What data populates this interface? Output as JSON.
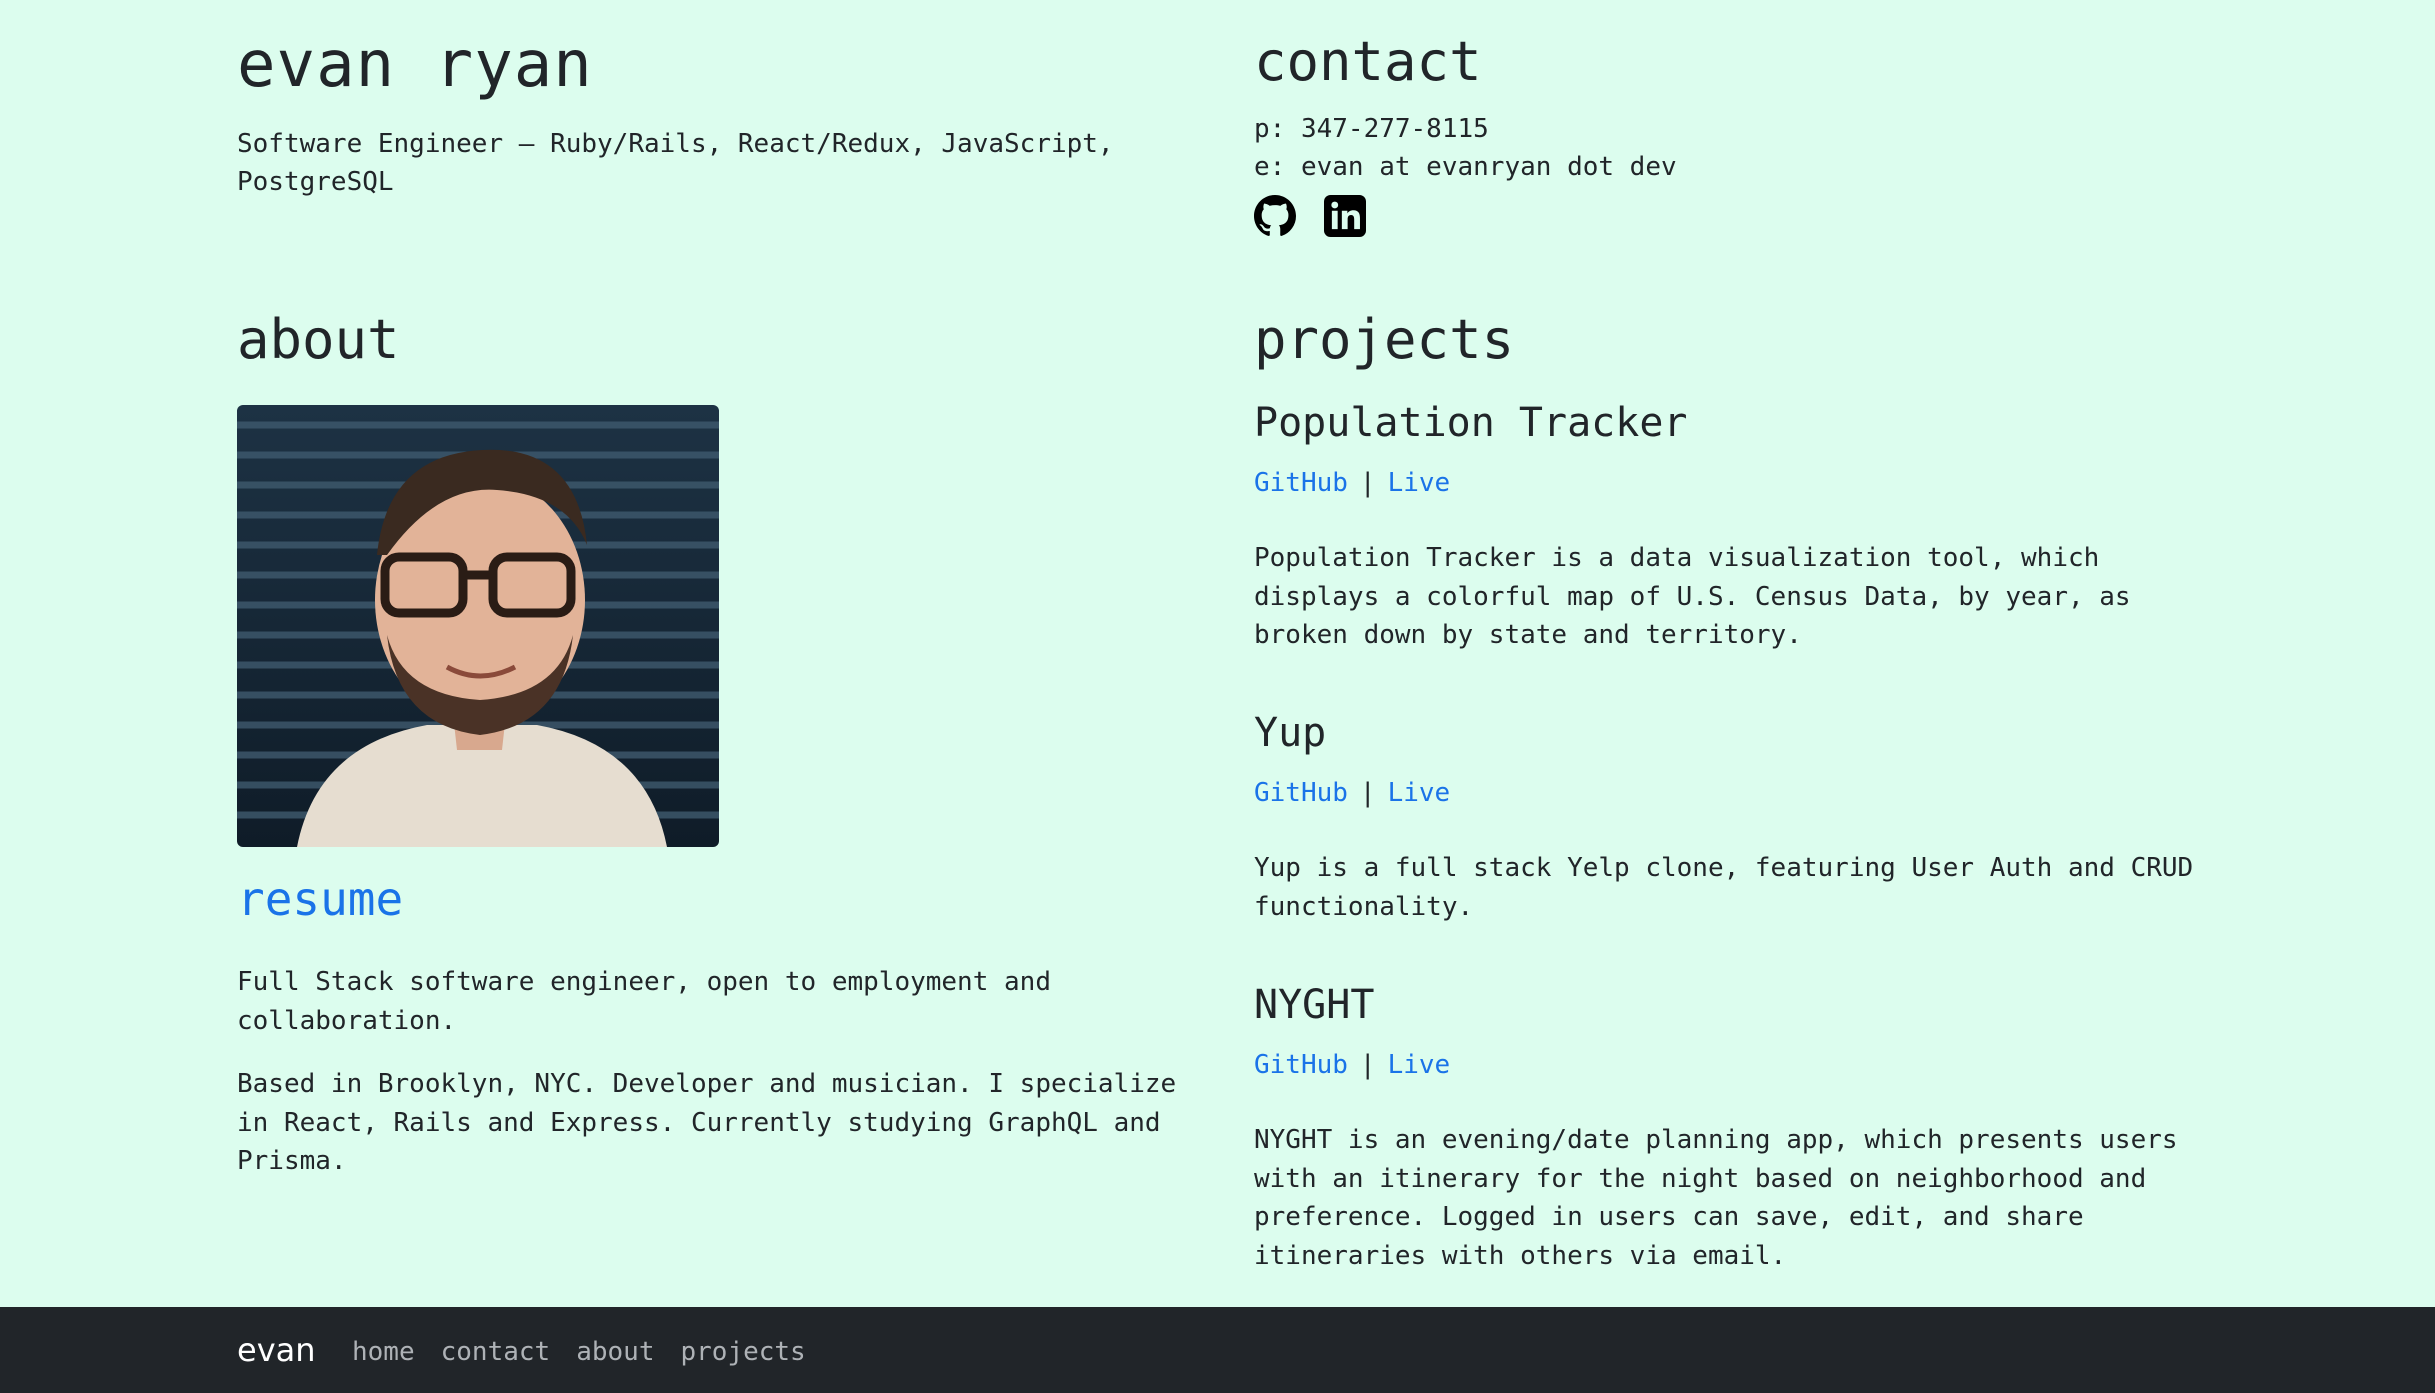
{
  "header": {
    "name": "evan ryan",
    "subtitle": "Software Engineer – Ruby/Rails, React/Redux, JavaScript, PostgreSQL"
  },
  "contact": {
    "heading": "contact",
    "phone": "p: 347-277-8115",
    "email": "e: evan at evanryan dot dev",
    "icons": [
      "github-icon",
      "linkedin-icon"
    ]
  },
  "about": {
    "heading": "about",
    "resume_label": "resume",
    "paragraph1": "Full Stack software engineer, open to employment and collaboration.",
    "paragraph2": "Based in Brooklyn, NYC. Developer and musician. I specialize in React, Rails and Express. Currently studying GraphQL and Prisma."
  },
  "projects": {
    "heading": "projects",
    "items": [
      {
        "title": "Population Tracker",
        "github_label": "GitHub",
        "live_label": "Live",
        "separator": "|",
        "description": "Population Tracker is a data visualization tool, which displays a colorful map of U.S. Census Data, by year, as broken down by state and territory."
      },
      {
        "title": "Yup",
        "github_label": "GitHub",
        "live_label": "Live",
        "separator": "|",
        "description": "Yup is a full stack Yelp clone, featuring User Auth and CRUD functionality."
      },
      {
        "title": "NYGHT",
        "github_label": "GitHub",
        "live_label": "Live",
        "separator": "|",
        "description": "NYGHT is an evening/date planning app, which presents users with an itinerary for the night based on neighborhood and preference. Logged in users can save, edit, and share itineraries with others via email."
      }
    ]
  },
  "footer": {
    "brand": "evan",
    "nav": [
      "home",
      "contact",
      "about",
      "projects"
    ]
  },
  "colors": {
    "background": "#dcfdee",
    "link": "#1a73e8",
    "footer": "#212529"
  }
}
